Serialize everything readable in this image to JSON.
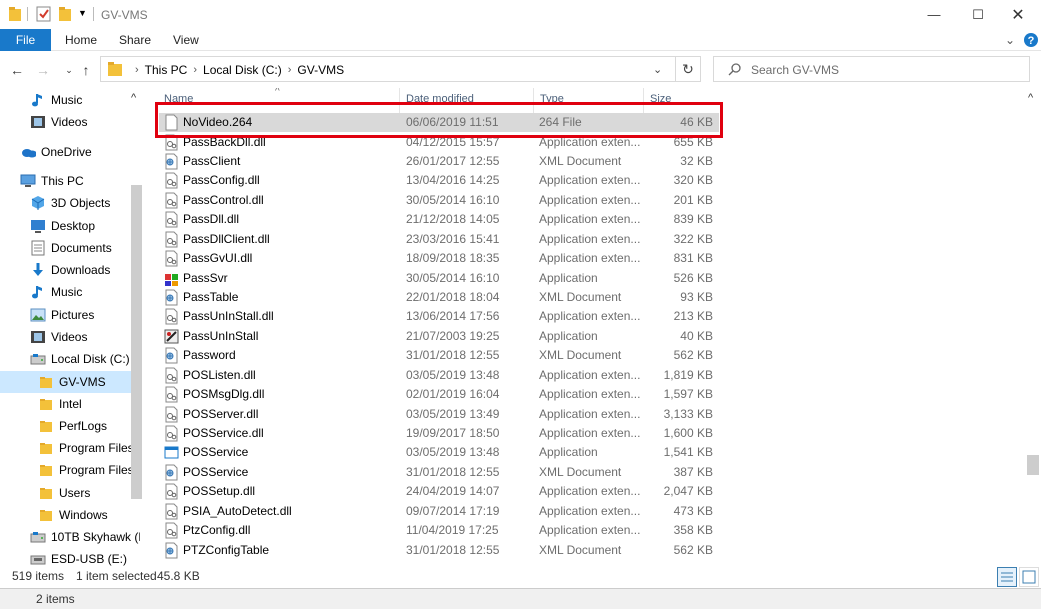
{
  "window": {
    "title": "GV-VMS"
  },
  "ribbon": {
    "file_label": "File",
    "tabs": [
      "Home",
      "Share",
      "View"
    ]
  },
  "address": {
    "crumbs": [
      "This PC",
      "Local Disk (C:)",
      "GV-VMS"
    ],
    "search_placeholder": "Search GV-VMS"
  },
  "nav": {
    "items": [
      {
        "label": "Music",
        "icon": "music-icon"
      },
      {
        "label": "Videos",
        "icon": "videos-icon"
      },
      {
        "label": "OneDrive",
        "icon": "onedrive-icon"
      },
      {
        "label": "This PC",
        "icon": "computer-icon"
      },
      {
        "label": "3D Objects",
        "icon": "3d-objects-icon"
      },
      {
        "label": "Desktop",
        "icon": "desktop-icon"
      },
      {
        "label": "Documents",
        "icon": "documents-icon"
      },
      {
        "label": "Downloads",
        "icon": "downloads-icon"
      },
      {
        "label": "Music",
        "icon": "music-icon"
      },
      {
        "label": "Pictures",
        "icon": "pictures-icon"
      },
      {
        "label": "Videos",
        "icon": "videos-icon"
      },
      {
        "label": "Local Disk (C:)",
        "icon": "drive-icon"
      },
      {
        "label": "GV-VMS",
        "icon": "folder-icon"
      },
      {
        "label": "Intel",
        "icon": "folder-icon"
      },
      {
        "label": "PerfLogs",
        "icon": "folder-icon"
      },
      {
        "label": "Program Files",
        "icon": "folder-icon"
      },
      {
        "label": "Program Files (",
        "icon": "folder-icon"
      },
      {
        "label": "Users",
        "icon": "folder-icon"
      },
      {
        "label": "Windows",
        "icon": "folder-icon"
      },
      {
        "label": "10TB Skyhawk (D",
        "icon": "drive-icon"
      },
      {
        "label": "ESD-USB (E:)",
        "icon": "usb-drive-icon"
      }
    ],
    "selected": "GV-VMS"
  },
  "columns": {
    "name": "Name",
    "date": "Date modified",
    "type": "Type",
    "size": "Size"
  },
  "files": [
    {
      "name": "NoVideo.264",
      "date": "06/06/2019 11:51",
      "type": "264 File",
      "size": "46 KB",
      "icon": "file-icon"
    },
    {
      "name": "PassBackDll.dll",
      "date": "04/12/2015 15:57",
      "type": "Application exten...",
      "size": "655 KB",
      "icon": "dll-icon"
    },
    {
      "name": "PassClient",
      "date": "26/01/2017 12:55",
      "type": "XML Document",
      "size": "32 KB",
      "icon": "xml-icon"
    },
    {
      "name": "PassConfig.dll",
      "date": "13/04/2016 14:25",
      "type": "Application exten...",
      "size": "320 KB",
      "icon": "dll-icon"
    },
    {
      "name": "PassControl.dll",
      "date": "30/05/2014 16:10",
      "type": "Application exten...",
      "size": "201 KB",
      "icon": "dll-icon"
    },
    {
      "name": "PassDll.dll",
      "date": "21/12/2018 14:05",
      "type": "Application exten...",
      "size": "839 KB",
      "icon": "dll-icon"
    },
    {
      "name": "PassDllClient.dll",
      "date": "23/03/2016 15:41",
      "type": "Application exten...",
      "size": "322 KB",
      "icon": "dll-icon"
    },
    {
      "name": "PassGvUI.dll",
      "date": "18/09/2018 18:35",
      "type": "Application exten...",
      "size": "831 KB",
      "icon": "dll-icon"
    },
    {
      "name": "PassSvr",
      "date": "30/05/2014 16:10",
      "type": "Application",
      "size": "526 KB",
      "icon": "app-icon"
    },
    {
      "name": "PassTable",
      "date": "22/01/2018 18:04",
      "type": "XML Document",
      "size": "93 KB",
      "icon": "xml-icon"
    },
    {
      "name": "PassUnInStall.dll",
      "date": "13/06/2014 17:56",
      "type": "Application exten...",
      "size": "213 KB",
      "icon": "dll-icon"
    },
    {
      "name": "PassUnInStall",
      "date": "21/07/2003 19:25",
      "type": "Application",
      "size": "40 KB",
      "icon": "installer-icon"
    },
    {
      "name": "Password",
      "date": "31/01/2018 12:55",
      "type": "XML Document",
      "size": "562 KB",
      "icon": "xml-icon"
    },
    {
      "name": "POSListen.dll",
      "date": "03/05/2019 13:48",
      "type": "Application exten...",
      "size": "1,819 KB",
      "icon": "dll-icon"
    },
    {
      "name": "POSMsgDlg.dll",
      "date": "02/01/2019 16:04",
      "type": "Application exten...",
      "size": "1,597 KB",
      "icon": "dll-icon"
    },
    {
      "name": "POSServer.dll",
      "date": "03/05/2019 13:49",
      "type": "Application exten...",
      "size": "3,133 KB",
      "icon": "dll-icon"
    },
    {
      "name": "POSService.dll",
      "date": "19/09/2017 18:50",
      "type": "Application exten...",
      "size": "1,600 KB",
      "icon": "dll-icon"
    },
    {
      "name": "POSService",
      "date": "03/05/2019 13:48",
      "type": "Application",
      "size": "1,541 KB",
      "icon": "app-window-icon"
    },
    {
      "name": "POSService",
      "date": "31/01/2018 12:55",
      "type": "XML Document",
      "size": "387 KB",
      "icon": "xml-icon"
    },
    {
      "name": "POSSetup.dll",
      "date": "24/04/2019 14:07",
      "type": "Application exten...",
      "size": "2,047 KB",
      "icon": "dll-icon"
    },
    {
      "name": "PSIA_AutoDetect.dll",
      "date": "09/07/2014 17:19",
      "type": "Application exten...",
      "size": "473 KB",
      "icon": "dll-icon"
    },
    {
      "name": "PtzConfig.dll",
      "date": "11/04/2019 17:25",
      "type": "Application exten...",
      "size": "358 KB",
      "icon": "dll-icon"
    },
    {
      "name": "PTZConfigTable",
      "date": "31/01/2018 12:55",
      "type": "XML Document",
      "size": "562 KB",
      "icon": "xml-icon"
    }
  ],
  "status": {
    "items": "519 items",
    "selected": "1 item selected",
    "size": "45.8 KB"
  },
  "taskbar": {
    "count": "2 items"
  }
}
